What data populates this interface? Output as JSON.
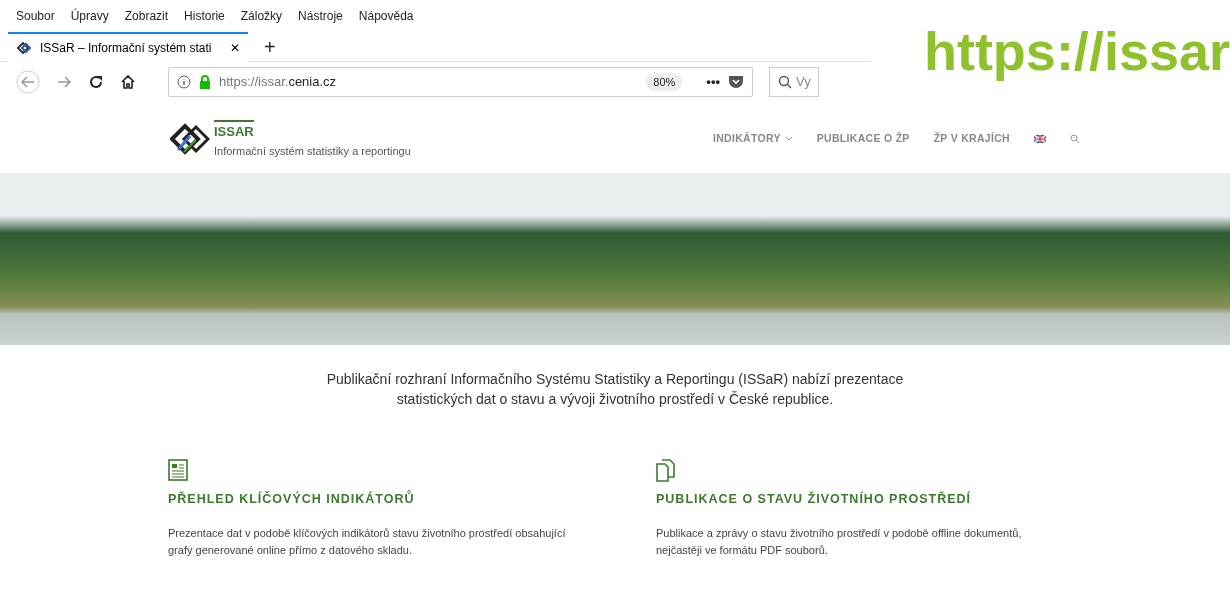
{
  "slide_title": "https://issar",
  "browser": {
    "menu": [
      "Soubor",
      "Úpravy",
      "Zobrazit",
      "Historie",
      "Záložky",
      "Nástroje",
      "Nápověda"
    ],
    "tabs": [
      {
        "title": "ISSaR – Informační systém stati",
        "selected": true,
        "close": "✕"
      }
    ],
    "new_tab": "+",
    "url_scheme": "https://issar.",
    "url_domain": "cenia.cz",
    "zoom": "80%",
    "page_actions": "•••",
    "search_placeholder": "Vy"
  },
  "site": {
    "logo_name": "ISSAR",
    "logo_tagline": "Informační systém statistiky a reportingu",
    "nav": [
      {
        "label": "INDIKÁTORY",
        "dropdown": true
      },
      {
        "label": "PUBLIKACE O ŽP",
        "dropdown": false
      },
      {
        "label": "ŽP V KRAJÍCH",
        "dropdown": false
      }
    ],
    "intro": "Publikační rozhraní Informačního Systému Statistiky a Reportingu (ISSaR) nabízí prezentace statistických dat o stavu a vývoji životního prostředí v České republice.",
    "features": [
      {
        "kind": "indicators",
        "title": "PŘEHLED KLÍČOVÝCH INDIKÁTORŮ",
        "text": "Prezentace dat v podobě klíčových indikátorů stavu životního prostředí obsahující grafy generované online přímo z datového skladu."
      },
      {
        "kind": "publications",
        "title": "PUBLIKACE O STAVU ŽIVOTNÍHO PROSTŘEDÍ",
        "text": "Publikace a zprávy o stavu životního prostředí v podobě offline dokumentů, nejčastěji ve formátu PDF souborů."
      }
    ]
  }
}
